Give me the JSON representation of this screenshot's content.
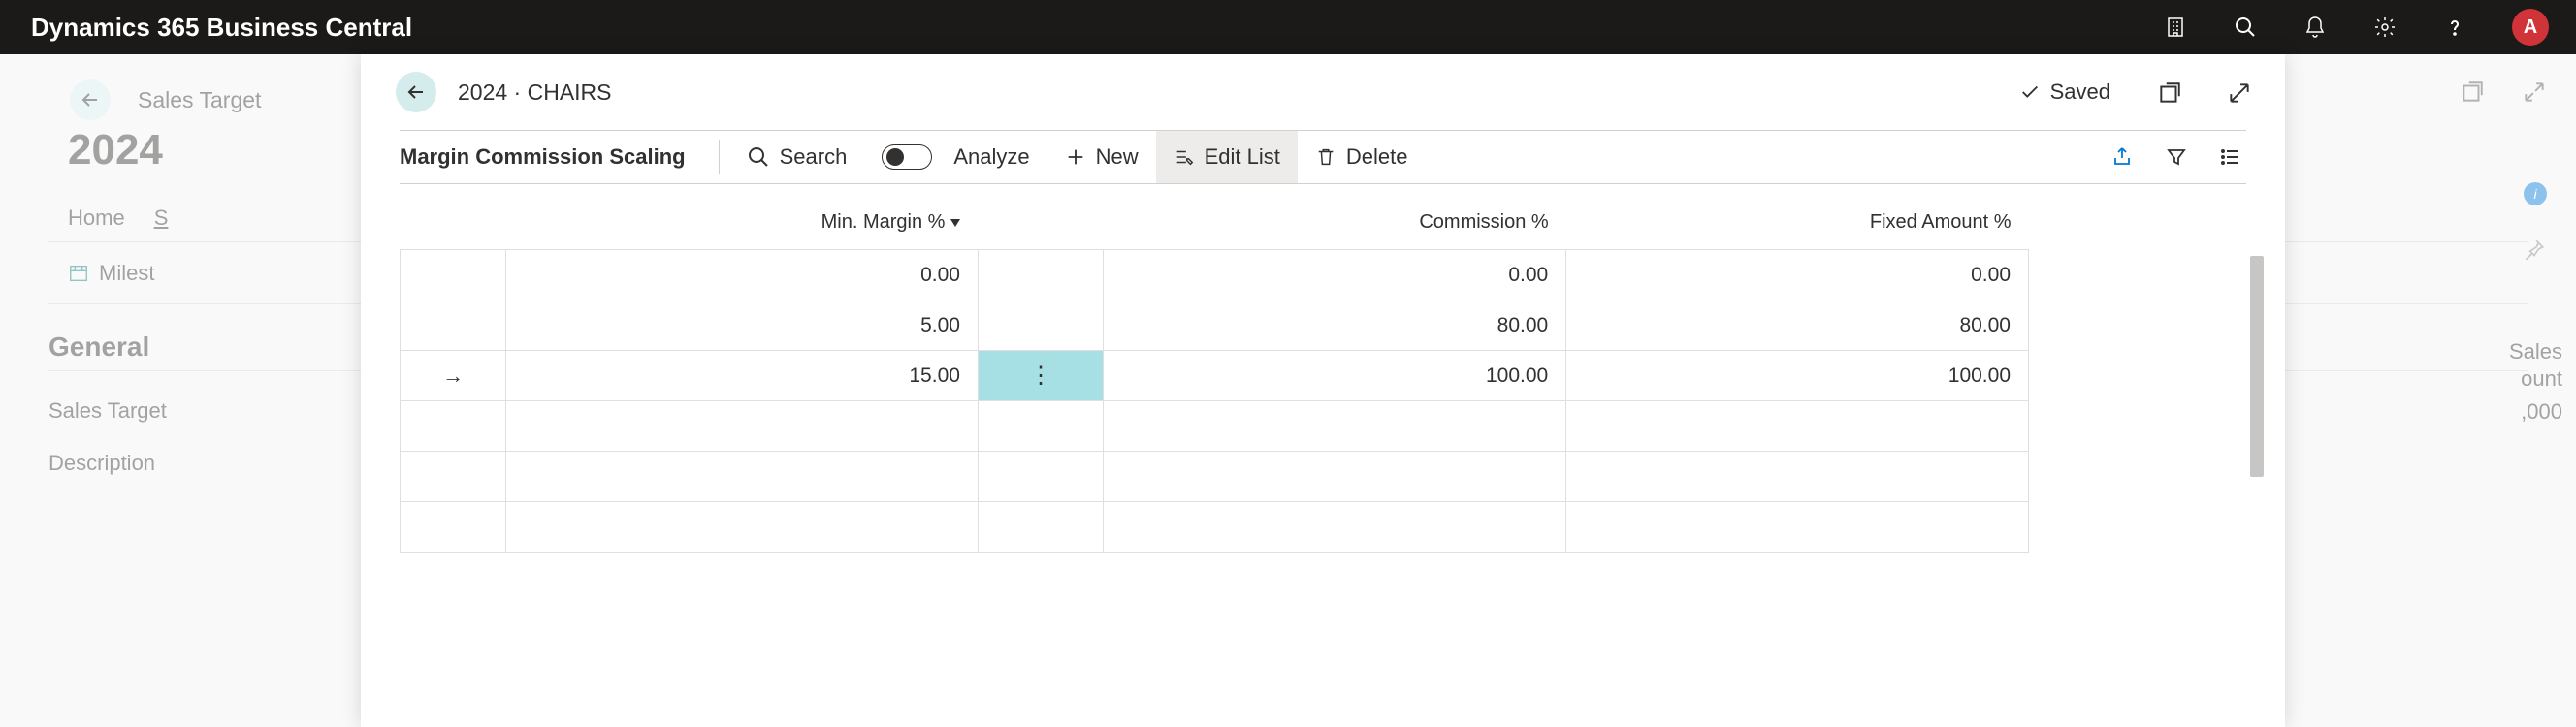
{
  "app": {
    "title": "Dynamics 365 Business Central",
    "avatar_initial": "A"
  },
  "back_page": {
    "breadcrumb": "Sales Target",
    "year": "2024",
    "nav": {
      "home": "Home",
      "second_visible": "S"
    },
    "sub_item": "Milest",
    "general_heading": "General",
    "field1_label": "Sales Target",
    "field2_label": "Description"
  },
  "right_frag": {
    "line1": "Sales",
    "line2": "ount",
    "line3": ",000"
  },
  "dialog": {
    "breadcrumb": "2024 · CHAIRS",
    "saved_label": "Saved",
    "toolbar": {
      "title": "Margin Commission Scaling",
      "search_label": "Search",
      "analyze_label": "Analyze",
      "new_label": "New",
      "edit_list_label": "Edit List",
      "delete_label": "Delete"
    },
    "columns": {
      "min_margin": "Min. Margin %",
      "commission": "Commission %",
      "fixed_amount": "Fixed Amount %"
    },
    "rows": [
      {
        "min_margin": "0.00",
        "commission": "0.00",
        "fixed_amount": "0.00",
        "active": false
      },
      {
        "min_margin": "5.00",
        "commission": "80.00",
        "fixed_amount": "80.00",
        "active": false
      },
      {
        "min_margin": "15.00",
        "commission": "100.00",
        "fixed_amount": "100.00",
        "active": true
      }
    ]
  }
}
